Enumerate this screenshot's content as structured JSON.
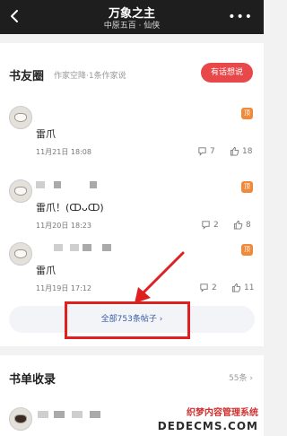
{
  "header": {
    "title": "万象之主",
    "subtitle": "中原五百 · 仙侠",
    "more_label": "•••"
  },
  "circle": {
    "title": "书友圈",
    "subtitle": "作家空降·1条作家说",
    "talk_button": "有话想说",
    "all_posts_label": "全部753条帖子 ›",
    "posts": [
      {
        "badge": "顶",
        "content": "雷爪",
        "date": "11月21日 18:08",
        "comments": "7",
        "likes": "18"
      },
      {
        "badge": "顶",
        "content": "雷爪！(ↀᴗↀ)",
        "date": "11月20日 18:23",
        "comments": "2",
        "likes": "8"
      },
      {
        "badge": "顶",
        "content": "雷爪",
        "date": "11月19日 17:12",
        "comments": "2",
        "likes": "11"
      }
    ]
  },
  "booklist": {
    "title": "书单收录",
    "count": "55条 ›"
  },
  "watermark": {
    "line1": "织梦内容管理系统",
    "line2": "DEDECMS.COM"
  },
  "colors": {
    "accent_red": "#e8484a",
    "link_blue": "#3b5ca8",
    "badge_orange": "#f08a3a"
  }
}
